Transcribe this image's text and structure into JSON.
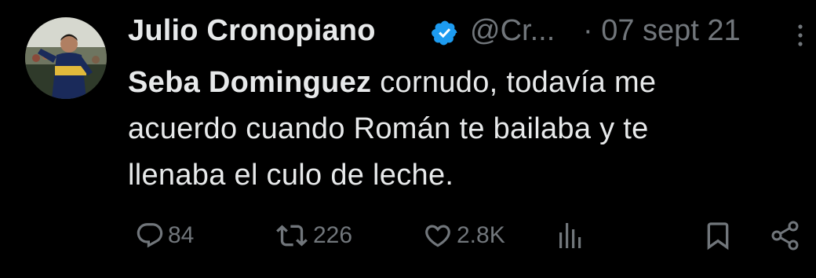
{
  "author": {
    "display_name": "Julio Cronopiano",
    "handle": "@Cr...",
    "verified_icon": "verified-badge-icon",
    "date": "· 07 sept 21",
    "avatar_icon": "avatar-photo"
  },
  "tweet": {
    "mention": "Seba Dominguez",
    "line1_rest": " cornudo, todavía me",
    "line2": "acuerdo cuando Román te bailaba y te",
    "line3": "llenaba el culo de leche."
  },
  "actions": {
    "replies": "84",
    "retweets": "226",
    "likes": "2.8K",
    "icons": [
      "reply-icon",
      "retweet-icon",
      "like-icon",
      "views-icon",
      "bookmark-icon",
      "share-icon"
    ]
  },
  "colors": {
    "background": "#000000",
    "primary_text": "#e7e9ea",
    "secondary_text": "#71767b",
    "verified_blue": "#1d9bf0"
  }
}
